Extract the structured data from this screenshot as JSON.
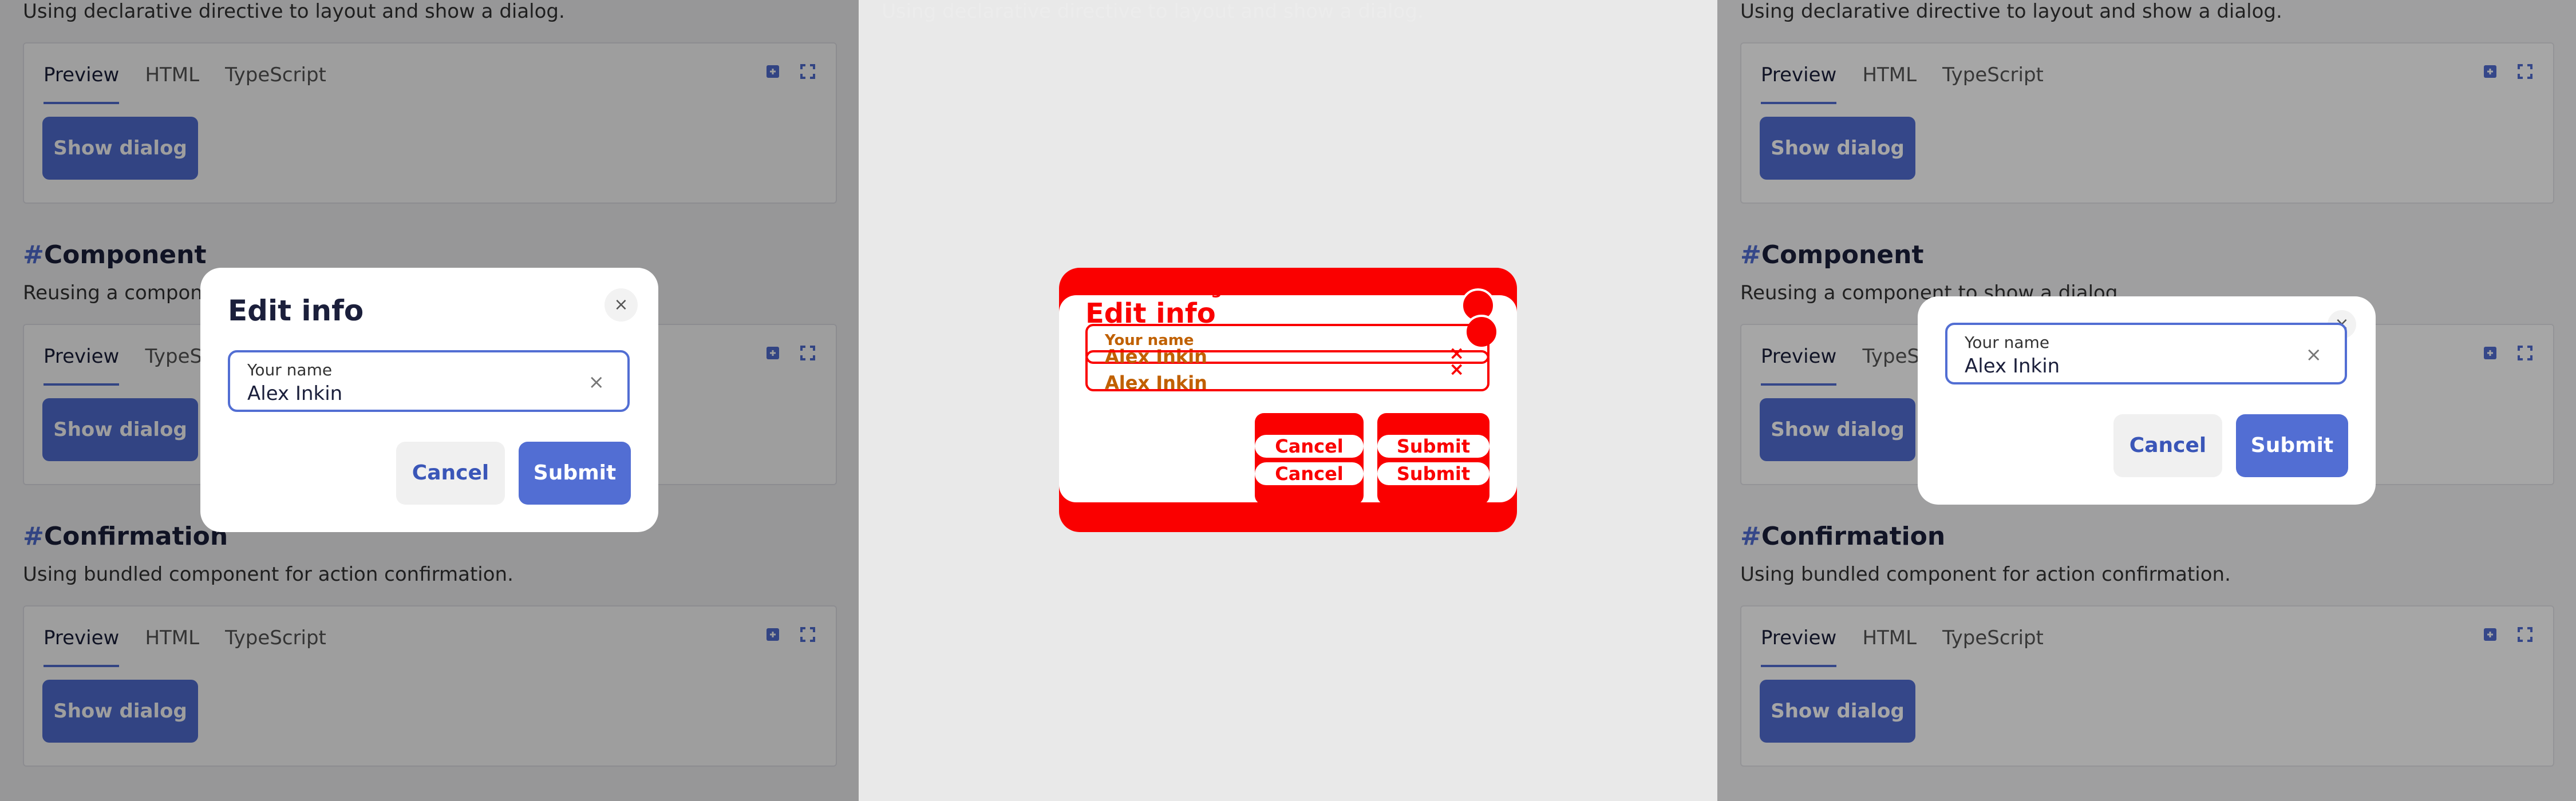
{
  "docs": {
    "declarative_desc": "Using declarative directive to layout and show a dialog.",
    "component_heading": "Component",
    "component_desc": "Reusing a component to show a dialog.",
    "confirmation_heading": "Confirmation",
    "confirmation_desc": "Using bundled component for action confirmation.",
    "hash": "#",
    "tabs": [
      "Preview",
      "HTML",
      "TypeScript"
    ],
    "show_dialog_label": "Show dialog"
  },
  "dialog": {
    "title": "Edit info",
    "field_label": "Your name",
    "field_value": "Alex Inkin",
    "cancel_label": "Cancel",
    "submit_label": "Submit",
    "close_glyph": "×",
    "clear_glyph": "×"
  },
  "highlight": {
    "overflow_text": "t to show a dialog."
  },
  "colors": {
    "accent": "#526ed3",
    "highlight": "#fa0000",
    "overlay": "rgba(0,0,0,0.38)"
  },
  "icons": [
    "expand-icon",
    "fullscreen-icon",
    "close-icon",
    "clear-icon"
  ]
}
